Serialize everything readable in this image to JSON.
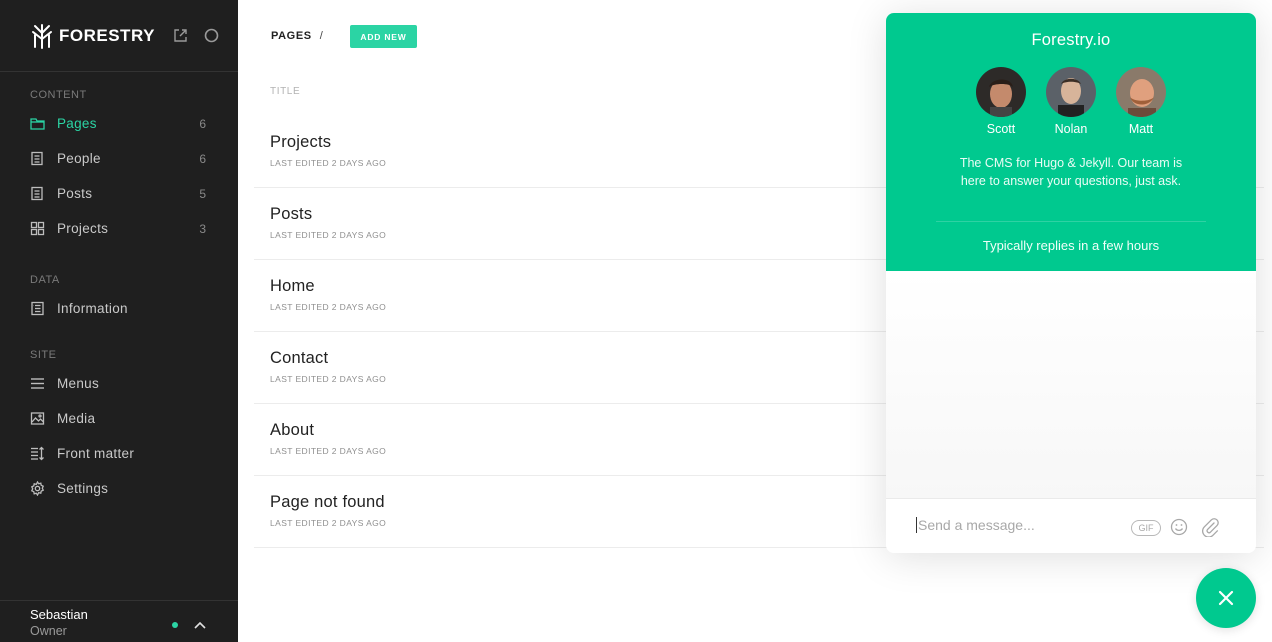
{
  "brand": {
    "name": "FORESTRY",
    "accent_color": "#2bd4a4"
  },
  "sidebar": {
    "sections": [
      {
        "label": "CONTENT",
        "items": [
          {
            "label": "Pages",
            "count": "6",
            "icon": "folder-icon",
            "active": true
          },
          {
            "label": "People",
            "count": "6",
            "icon": "document-icon"
          },
          {
            "label": "Posts",
            "count": "5",
            "icon": "document-icon"
          },
          {
            "label": "Projects",
            "count": "3",
            "icon": "grid-icon"
          }
        ]
      },
      {
        "label": "DATA",
        "items": [
          {
            "label": "Information",
            "icon": "data-file-icon"
          }
        ]
      },
      {
        "label": "SITE",
        "items": [
          {
            "label": "Menus",
            "icon": "menu-lines-icon"
          },
          {
            "label": "Media",
            "icon": "image-icon"
          },
          {
            "label": "Front matter",
            "icon": "sort-list-icon"
          },
          {
            "label": "Settings",
            "icon": "gear-icon"
          }
        ]
      }
    ],
    "user": {
      "name": "Sebastian",
      "role": "Owner",
      "status_color": "#2bd4a4"
    }
  },
  "main": {
    "breadcrumb": "PAGES",
    "breadcrumb_sep": "/",
    "add_new_label": "ADD NEW",
    "column_title": "TITLE",
    "pages": [
      {
        "title": "Projects",
        "meta": "LAST EDITED 2 DAYS AGO"
      },
      {
        "title": "Posts",
        "meta": "LAST EDITED 2 DAYS AGO"
      },
      {
        "title": "Home",
        "meta": "LAST EDITED 2 DAYS AGO"
      },
      {
        "title": "Contact",
        "meta": "LAST EDITED 2 DAYS AGO"
      },
      {
        "title": "About",
        "meta": "LAST EDITED 2 DAYS AGO"
      },
      {
        "title": "Page not found",
        "meta": "LAST EDITED 2 DAYS AGO"
      }
    ]
  },
  "chat": {
    "title": "Forestry.io",
    "team": [
      {
        "name": "Scott"
      },
      {
        "name": "Nolan"
      },
      {
        "name": "Matt"
      }
    ],
    "description": "The CMS for Hugo & Jekyll. Our team is here to answer your questions, just ask.",
    "reply_time": "Typically replies in a few hours",
    "input_placeholder": "Send a message...",
    "gif_label": "GIF",
    "header_color": "#00c98f"
  }
}
